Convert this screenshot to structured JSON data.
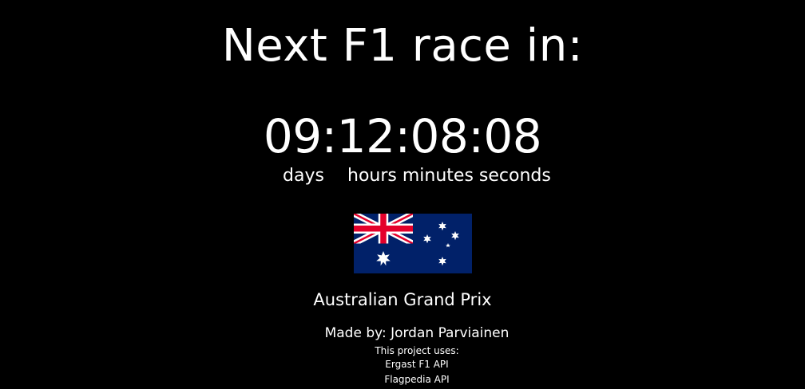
{
  "heading": "Next F1 race in:",
  "countdown": {
    "display": "09:12:08:08",
    "days": "09",
    "hours": "12",
    "minutes": "08",
    "seconds": "08",
    "unit_days": "days",
    "unit_hours_minutes_seconds": "hours minutes seconds"
  },
  "race": {
    "name": "Australian Grand Prix",
    "flag_icon": "australia-flag-icon",
    "flag_colors": {
      "blue": "#012169",
      "red": "#E4002B",
      "white": "#FFFFFF"
    }
  },
  "footer": {
    "made_by": "Made by: Jordan Parviainen",
    "uses_label": "This project uses:",
    "apis": [
      "Ergast F1 API",
      "Flagpedia API"
    ]
  },
  "colors": {
    "background": "#000000",
    "text": "#FFFFFF"
  }
}
